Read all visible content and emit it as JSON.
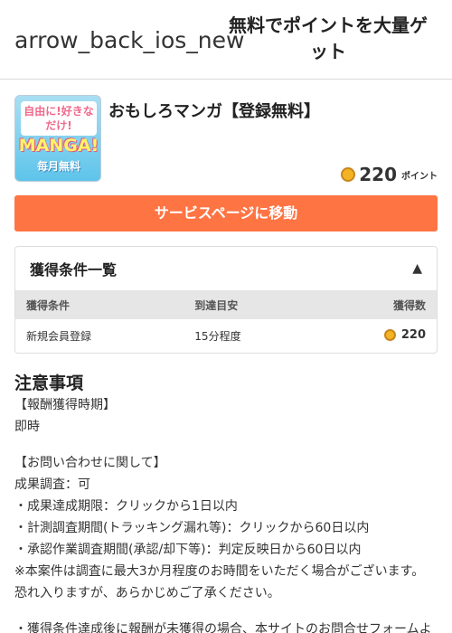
{
  "header": {
    "back_icon_text": "arrow_back_ios_new",
    "title": "無料でポイントを大量ゲット"
  },
  "offer": {
    "thumb_line1": "自由に!好きなだけ!",
    "thumb_line2": "MANGA!",
    "thumb_line3": "毎月無料",
    "title": "おもしろマンガ【登録無料】",
    "points": "220",
    "points_unit": "ポイント",
    "cta_label": "サービスページに移動"
  },
  "conditions": {
    "heading": "獲得条件一覧",
    "columns": [
      "獲得条件",
      "到達目安",
      "獲得数"
    ],
    "rows": [
      {
        "condition": "新規会員登録",
        "eta": "15分程度",
        "points": "220"
      }
    ]
  },
  "notes": {
    "heading": "注意事項",
    "lines": [
      "【報酬獲得時期】",
      "即時",
      "",
      "【お問い合わせに関して】",
      "成果調査：可",
      "・成果達成期限：クリックから1日以内",
      "・計測調査期間(トラッキング漏れ等)：クリックから60日以内",
      "・承認作業調査期間(承認/却下等)：判定反映日から60日以内",
      "※本案件は調査に最大3か月程度のお時間をいただく場合がございます。",
      "恐れ入りますが、あらかじめご了承ください。",
      "",
      "・獲得条件達成後に報酬が未獲得の場合、本サイトのお問合せフォームよ"
    ]
  },
  "colors": {
    "accent": "#ff7443",
    "table_header": "#e6e6e6",
    "coin": "#f4b324"
  }
}
